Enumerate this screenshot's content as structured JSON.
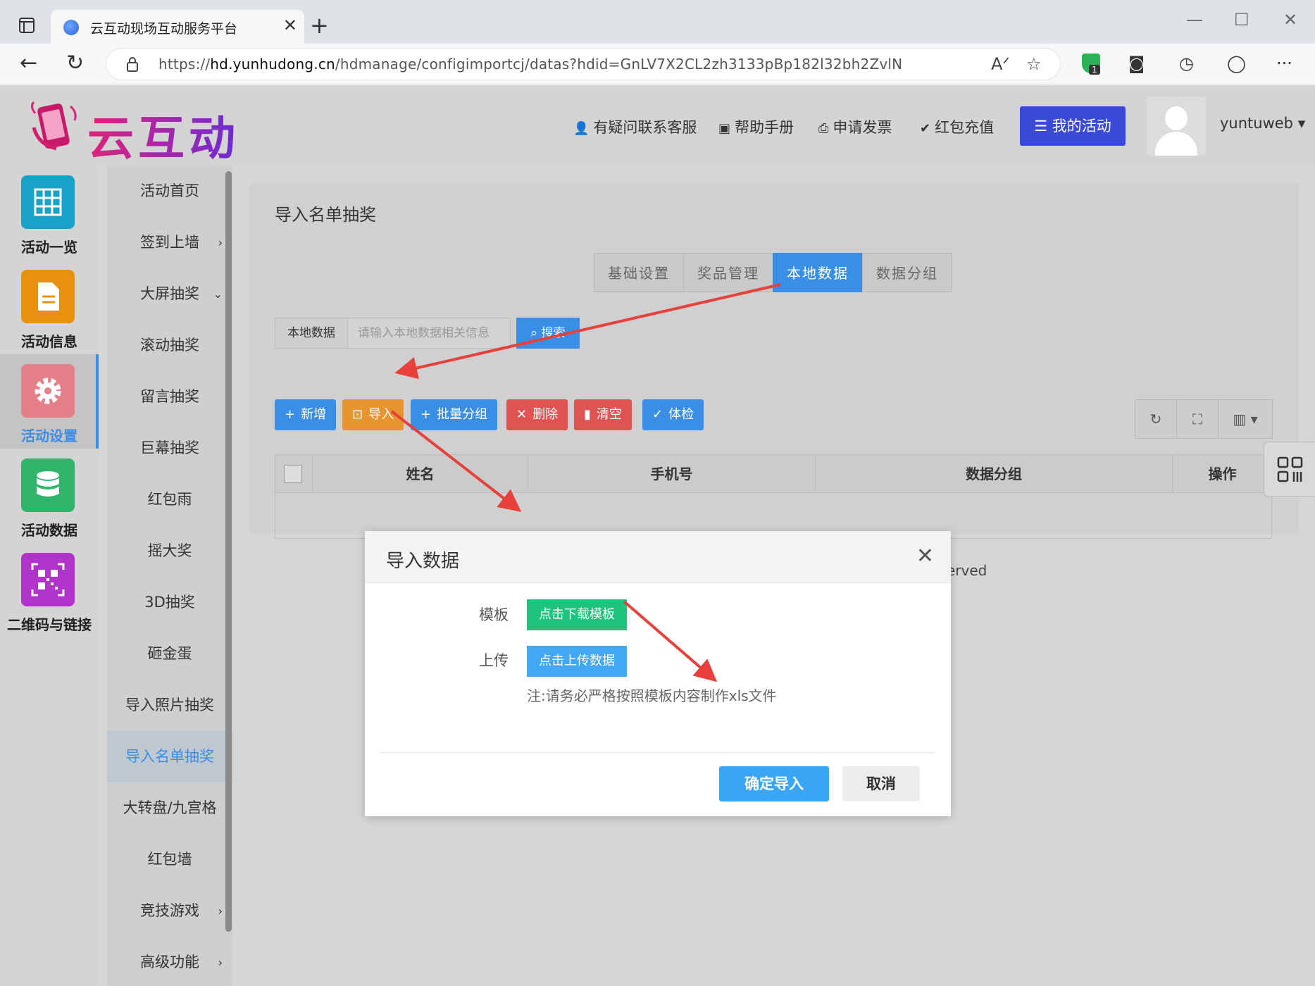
{
  "browser": {
    "tab_title": "云互动现场互动服务平台",
    "url_domain": "hd.yunhudong.cn",
    "url_prefix": "https://",
    "url_path": "/hdmanage/configimportcj/datas?hdid=GnLV7X2CL2zh3133pBp182l32bh2ZvlN",
    "extension_badge": "1"
  },
  "header": {
    "logo_text": "云互动",
    "links": [
      "有疑问联系客服",
      "帮助手册",
      "申请发票",
      "红包充值"
    ],
    "my_activity": "我的活动",
    "username": "yuntuweb"
  },
  "rail": [
    {
      "label": "活动一览",
      "icon": "grid-icon",
      "color": "#17a2c8"
    },
    {
      "label": "活动信息",
      "icon": "document-icon",
      "color": "#e8900f"
    },
    {
      "label": "活动设置",
      "icon": "gear-icon",
      "color": "#e57f88"
    },
    {
      "label": "活动数据",
      "icon": "database-icon",
      "color": "#2fb56b"
    },
    {
      "label": "二维码与链接",
      "icon": "qrcode-icon",
      "color": "#b133c9"
    }
  ],
  "submenu": [
    {
      "label": "活动首页",
      "arrow": ""
    },
    {
      "label": "签到上墙",
      "arrow": "›"
    },
    {
      "label": "大屏抽奖",
      "arrow": "⌄"
    },
    {
      "label": "滚动抽奖",
      "arrow": ""
    },
    {
      "label": "留言抽奖",
      "arrow": ""
    },
    {
      "label": "巨幕抽奖",
      "arrow": ""
    },
    {
      "label": "红包雨",
      "arrow": ""
    },
    {
      "label": "摇大奖",
      "arrow": ""
    },
    {
      "label": "3D抽奖",
      "arrow": ""
    },
    {
      "label": "砸金蛋",
      "arrow": ""
    },
    {
      "label": "导入照片抽奖",
      "arrow": ""
    },
    {
      "label": "导入名单抽奖",
      "arrow": ""
    },
    {
      "label": "大转盘/九宫格",
      "arrow": ""
    },
    {
      "label": "红包墙",
      "arrow": ""
    },
    {
      "label": "竞技游戏",
      "arrow": "›"
    },
    {
      "label": "高级功能",
      "arrow": "›"
    }
  ],
  "main": {
    "title": "导入名单抽奖",
    "tabs": [
      "基础设置",
      "奖品管理",
      "本地数据",
      "数据分组"
    ],
    "search_label": "本地数据",
    "search_placeholder": "请输入本地数据相关信息",
    "search_button": "搜索",
    "toolbar": {
      "add": "新增",
      "import": "导入",
      "batch_group": "批量分组",
      "delete": "删除",
      "clear": "清空",
      "check": "体检"
    },
    "table_headers": [
      "姓名",
      "手机号",
      "数据分组",
      "操作"
    ],
    "footer_partial": "erved"
  },
  "modal": {
    "title": "导入数据",
    "template_label": "模板",
    "template_button": "点击下载模板",
    "upload_label": "上传",
    "upload_button": "点击上传数据",
    "note": "注:请务必严格按照模板内容制作xls文件",
    "confirm": "确定导入",
    "cancel": "取消"
  },
  "colors": {
    "primary": "#3a8ee6",
    "annotation_arrow": "#e8403a"
  }
}
